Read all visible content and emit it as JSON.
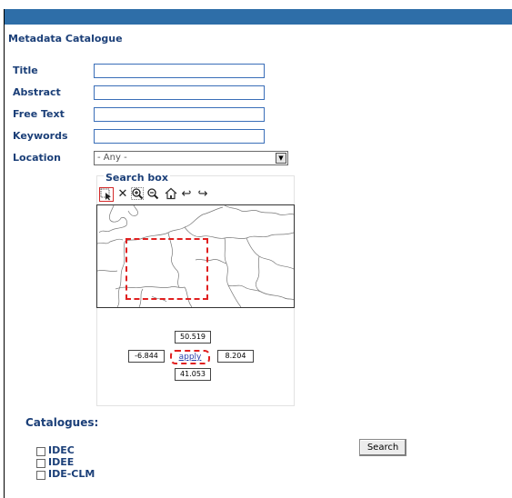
{
  "app": {
    "title": "Metadata Catalogue"
  },
  "form": {
    "title_label": "Title",
    "abstract_label": "Abstract",
    "free_text_label": "Free Text",
    "keywords_label": "Keywords",
    "location_label": "Location",
    "title_value": "",
    "abstract_value": "",
    "free_text_value": "",
    "keywords_value": "",
    "location_selected": "- Any -"
  },
  "search_box": {
    "legend": "Search box",
    "north": "50.519",
    "west": "-6.844",
    "east": "8.204",
    "south": "41.053",
    "apply_label": "apply",
    "tools": [
      "select-tool-icon",
      "clear-icon",
      "zoom-in-icon",
      "zoom-out-icon",
      "home-icon",
      "back-icon",
      "forward-icon"
    ]
  },
  "catalogues": {
    "label": "Catalogues:",
    "items": [
      "IDEC",
      "IDEE",
      "IDE-CLM"
    ]
  },
  "actions": {
    "search_label": "Search"
  },
  "colors": {
    "header_bar": "#2e6ea8",
    "label_text": "#1b3f78",
    "selection_red": "#e02020"
  }
}
